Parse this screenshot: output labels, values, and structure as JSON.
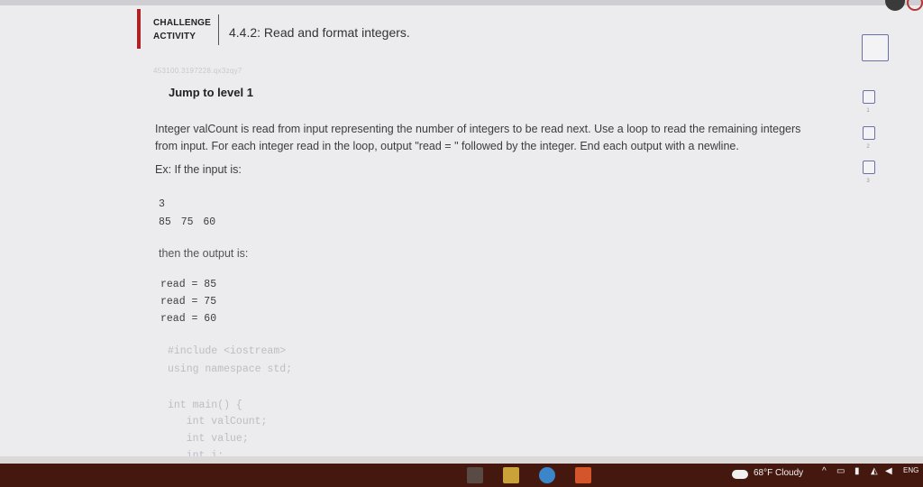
{
  "header": {
    "kind_line1": "CHALLENGE",
    "kind_line2": "ACTIVITY",
    "title": "4.4.2: Read and format integers."
  },
  "activity_id": "453100.3197228.qx3zqy7",
  "jump_link": "Jump to level 1",
  "description": {
    "line1": "Integer valCount is read from input representing the number of integers to be read next. Use a loop to read the remaining integers",
    "line2": "from input. For each integer read in the loop, output \"read = \" followed by the integer. End each output with a newline."
  },
  "example": {
    "intro": "Ex: If the input is:",
    "input_count": "3",
    "input_values": "85 75 60",
    "output_label": "then the output is:",
    "output_lines": [
      "read = 85",
      "read = 75",
      "read = 60"
    ]
  },
  "code_lines": [
    "#include <iostream>",
    "using namespace std;",
    "int main() {",
    "   int valCount;",
    "   int value;",
    "   int i;"
  ],
  "progress": {
    "levels": [
      "1",
      "2",
      "3"
    ]
  },
  "taskbar": {
    "weather": "68°F  Cloudy",
    "language": "ENG"
  },
  "colors": {
    "accent_red": "#b02222",
    "checkbox_border": "#6a6fa6",
    "taskbar": "#45180f"
  }
}
